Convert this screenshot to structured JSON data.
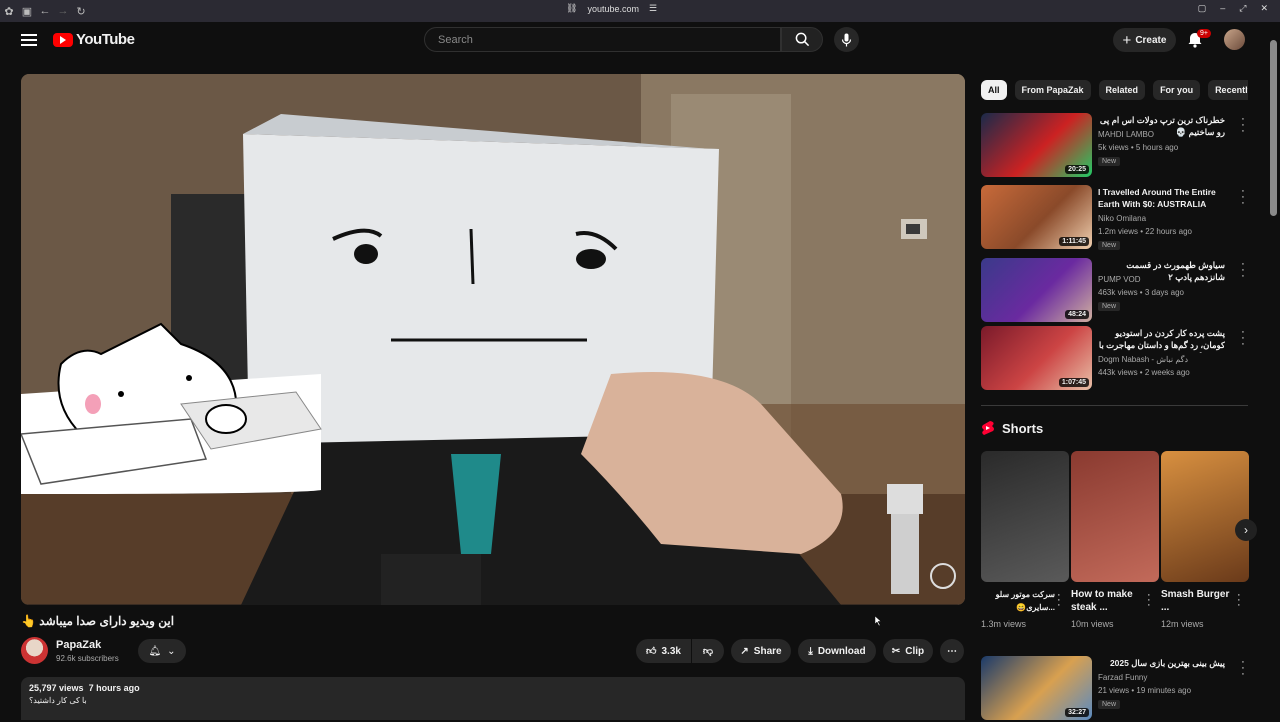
{
  "browser": {
    "url": "youtube.com"
  },
  "header": {
    "logo": "YouTube",
    "search_placeholder": "Search",
    "create_label": "Create",
    "notif_count": "9+"
  },
  "video": {
    "title": "این ویدیو دارای صدا میباشد 👆",
    "channel": "PapaZak",
    "subscribers": "92.6k subscribers",
    "likes": "3.3k",
    "share_label": "Share",
    "download_label": "Download",
    "clip_label": "Clip",
    "views": "25,797 views",
    "posted": "7 hours ago",
    "description": "با کی کار داشتید؟"
  },
  "chips": [
    "All",
    "From PapaZak",
    "Related",
    "For you",
    "Recently uploaded"
  ],
  "recommendations": [
    {
      "title": "خطرناک ترین ترپ دولات اس ام پی رو ساختیم 💀",
      "rtl": true,
      "channel": "MAHDI LAMBO",
      "meta": "5k views • 5 hours ago",
      "badge": "New",
      "duration": "20:25",
      "colors": [
        "#1a2a4a",
        "#c22",
        "#2c6"
      ]
    },
    {
      "title": "I Travelled Around The Entire Earth With $0: AUSTRALIA",
      "rtl": false,
      "channel": "Niko Omilana",
      "meta": "1.2m views • 22 hours ago",
      "badge": "New",
      "duration": "1:11:45",
      "colors": [
        "#c86a3a",
        "#8a4a2a",
        "#f0d0b0"
      ]
    },
    {
      "title": "سیاوش طهمورث در قسمت شانزدهم پادپ ۲",
      "rtl": true,
      "channel": "PUMP VOD",
      "meta": "463k views • 3 days ago",
      "badge": "New",
      "duration": "48:24",
      "colors": [
        "#3a3a8a",
        "#6a2aa0",
        "#d0b0a0"
      ]
    },
    {
      "title": "پشت پرده کار کردن در استودیو کومان، رد‌ گم‌ها و داستان مهاجرت با هلیا - دگم نباش",
      "rtl": true,
      "channel": "Dogm Nabash - دگم نباش",
      "meta": "443k views • 2 weeks ago",
      "badge": "",
      "duration": "1:07:45",
      "colors": [
        "#7a1a2a",
        "#c44",
        "#e8c0a8"
      ]
    },
    {
      "title": "پیش بینی بهترین بازی سال 2025",
      "rtl": true,
      "channel": "Farzad Funny",
      "meta": "21 views • 19 minutes ago",
      "badge": "New",
      "duration": "32:27",
      "colors": [
        "#1a3a6a",
        "#d8a050",
        "#5a8ac0"
      ]
    }
  ],
  "shorts": {
    "heading": "Shorts",
    "items": [
      {
        "title": "سرکت موتور سلو ...سایری😄",
        "rtl": true,
        "views": "1.3m views",
        "colors": [
          "#2a2a2a",
          "#5a5a5a"
        ]
      },
      {
        "title": "How to make steak ...",
        "rtl": false,
        "views": "10m views",
        "colors": [
          "#8a3a30",
          "#c26a5a"
        ]
      },
      {
        "title": "Smash Burger ...",
        "rtl": false,
        "views": "12m views",
        "colors": [
          "#d89040",
          "#6a3a1a"
        ]
      }
    ]
  },
  "colors": {
    "background": "#0f0f0f",
    "surface": "#272727",
    "accent": "#ff0000",
    "muted_text": "#aaaaaa"
  }
}
